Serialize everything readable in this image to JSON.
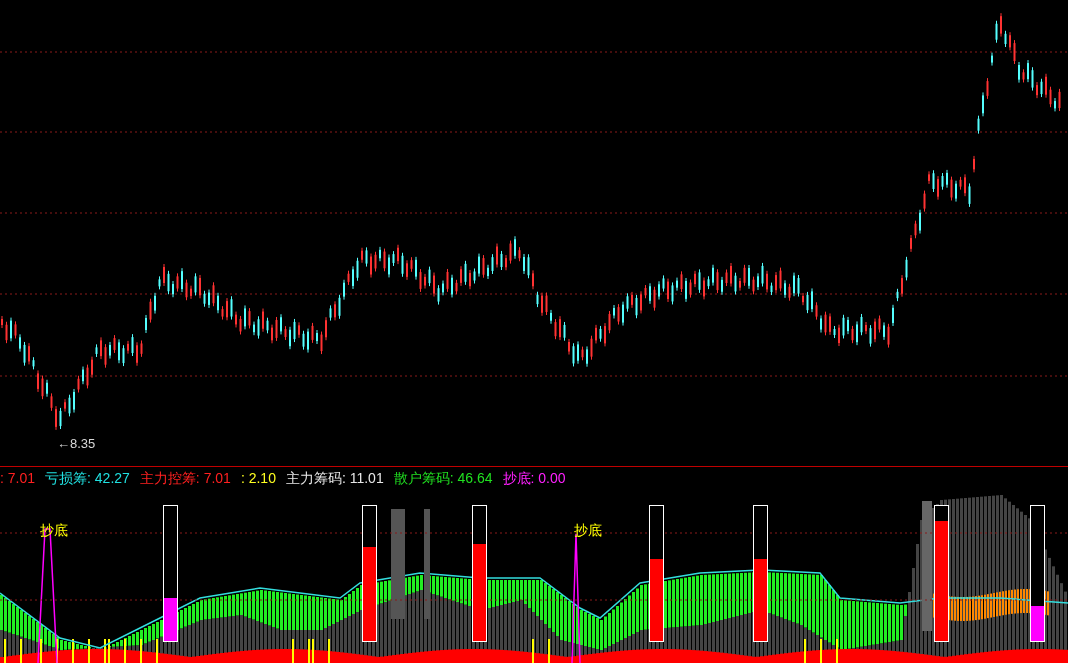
{
  "price_chart": {
    "low_marker": "←8.35"
  },
  "indicator_legend": [
    {
      "text": ": 7.01",
      "color": "#ff2020"
    },
    {
      "text": "亏损筹: 42.27",
      "color": "#20e0e0"
    },
    {
      "text": "主力控筹: 7.01",
      "color": "#ff2020"
    },
    {
      "text": ": 2.10",
      "color": "#ffff20"
    },
    {
      "text": "主力筹码: 11.01",
      "color": "#e8e8e8"
    },
    {
      "text": "散户筹码: 46.64",
      "color": "#20e020"
    },
    {
      "text": "抄底: 0.00",
      "color": "#ff20ff"
    }
  ],
  "signal_labels": [
    "抄底",
    "抄底"
  ],
  "gauges": [
    {
      "level": 0.32,
      "color": "#ff00ff"
    },
    {
      "level": 0.7,
      "color": "#ff0000"
    },
    {
      "level": 0.72,
      "color": "#ff0000"
    },
    {
      "level": 0.61,
      "color": "#ff0000"
    },
    {
      "level": 0.61,
      "color": "#ff0000"
    },
    {
      "level": 0.89,
      "color": "#ff0000"
    },
    {
      "level": 0.26,
      "color": "#ff00ff"
    }
  ]
}
